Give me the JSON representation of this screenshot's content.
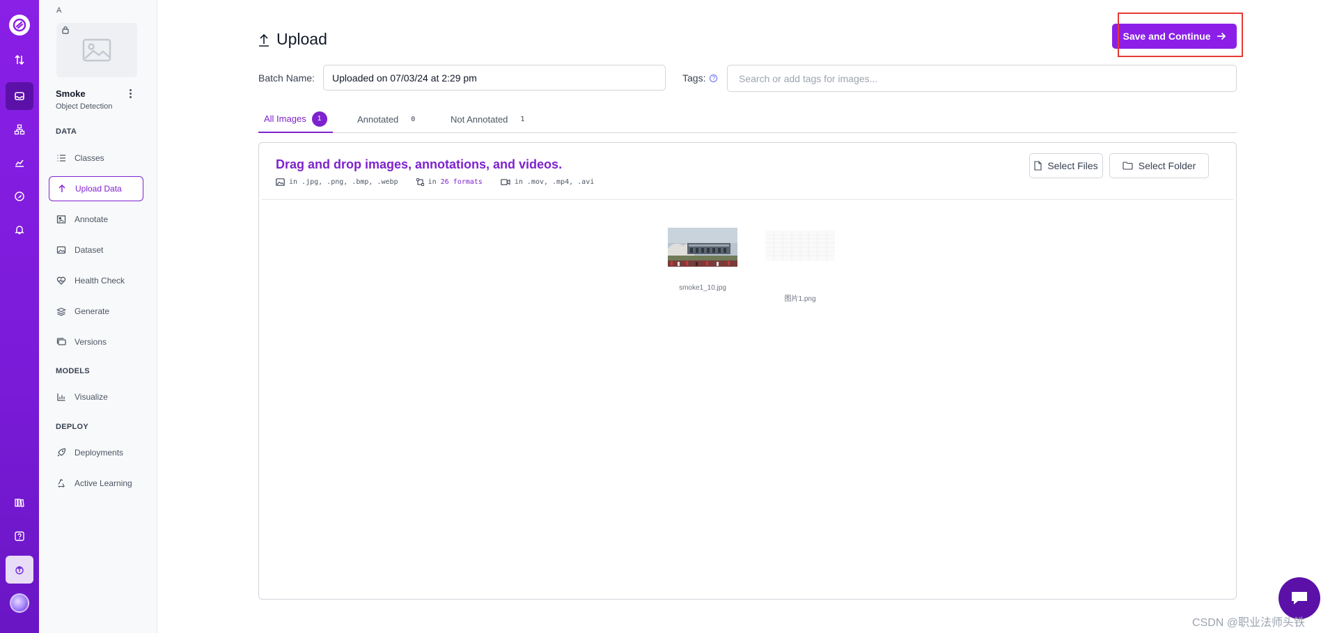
{
  "rail": {
    "icons": [
      "logo-icon",
      "transfer-icon",
      "inbox-icon",
      "workflow-icon",
      "chart-icon",
      "explore-icon",
      "bell-icon",
      "docs-icon",
      "help-icon",
      "upload-icon",
      "avatar"
    ]
  },
  "project": {
    "workspace_letter": "A",
    "name": "Smoke",
    "type": "Object Detection"
  },
  "sidebar": {
    "data_section": "DATA",
    "models_section": "MODELS",
    "deploy_section": "DEPLOY",
    "items": [
      {
        "label": "Classes",
        "icon": "list-icon"
      },
      {
        "label": "Upload Data",
        "icon": "upload-arrow-icon",
        "active": true
      },
      {
        "label": "Annotate",
        "icon": "annotate-icon"
      },
      {
        "label": "Dataset",
        "icon": "image-icon"
      },
      {
        "label": "Health Check",
        "icon": "heart-icon"
      },
      {
        "label": "Generate",
        "icon": "layers-icon"
      },
      {
        "label": "Versions",
        "icon": "stack-icon"
      },
      {
        "label": "Visualize",
        "icon": "bar-chart-icon"
      },
      {
        "label": "Deployments",
        "icon": "rocket-icon"
      },
      {
        "label": "Active Learning",
        "icon": "recycle-icon"
      }
    ]
  },
  "header": {
    "title": "Upload",
    "save_label": "Save and Continue"
  },
  "form": {
    "batch_label": "Batch Name:",
    "batch_value": "Uploaded on 07/03/24 at 2:29 pm",
    "tags_label": "Tags:",
    "tags_placeholder": "Search or add tags for images..."
  },
  "tabs": [
    {
      "label": "All Images",
      "count": "1",
      "active": true
    },
    {
      "label": "Annotated",
      "count": "0"
    },
    {
      "label": "Not Annotated",
      "count": "1"
    }
  ],
  "dropzone": {
    "title": "Drag and drop images, annotations, and videos.",
    "images_formats": "in .jpg, .png, .bmp, .webp",
    "annotations_prefix": "in",
    "annotations_link": "26 formats",
    "video_formats": "in .mov, .mp4, .avi",
    "select_files": "Select Files",
    "select_folder": "Select Folder"
  },
  "files": [
    {
      "name": "smoke1_10.jpg"
    },
    {
      "name": "图片1.png"
    }
  ],
  "watermark": "CSDN @职业法师头铁",
  "colors": {
    "accent": "#7e22ce",
    "rail": "#8a1fe6",
    "save": "#8b1fe8",
    "highlight": "#e53935"
  }
}
